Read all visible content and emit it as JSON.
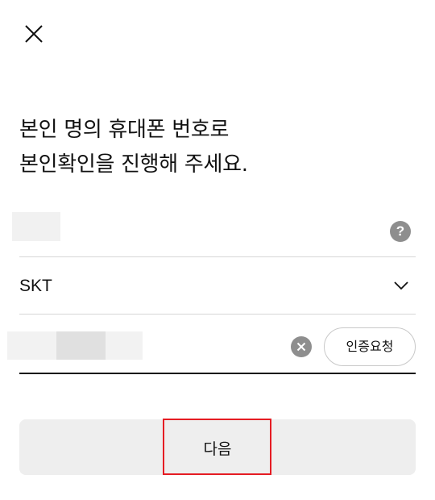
{
  "header": {
    "close_icon": "close-icon"
  },
  "title": {
    "line1": "본인 명의 휴대폰 번호로",
    "line2": "본인확인을 진행해 주세요."
  },
  "name_field": {
    "value": "",
    "help_icon": "question-circle-icon",
    "help_glyph": "?"
  },
  "carrier_field": {
    "value": "SKT",
    "icon": "chevron-down-icon"
  },
  "phone_field": {
    "value": "",
    "clear_icon": "clear-circle-icon",
    "request_button_label": "인증요청"
  },
  "next_button": {
    "label": "다음"
  },
  "colors": {
    "highlight": "#e51c23",
    "button_bg": "#eeeeee",
    "icon_gray": "#8e8e8e",
    "divider": "#d6d6d6"
  }
}
